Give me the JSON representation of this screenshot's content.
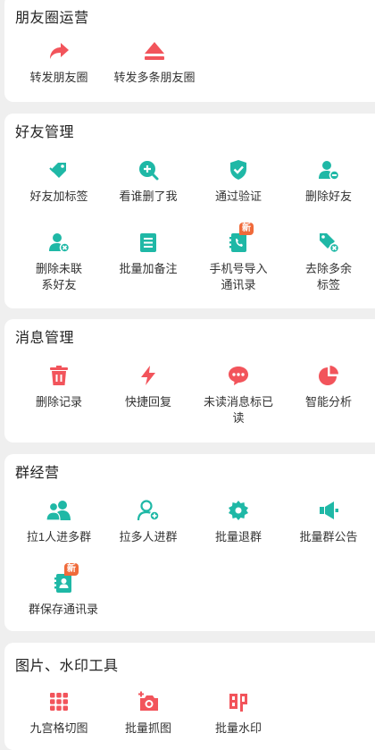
{
  "colors": {
    "teal": "#1fb8a6",
    "red": "#f2545b",
    "badge": "#f06a3a",
    "bg": "#efefef"
  },
  "sections": {
    "moments": {
      "title": "朋友圈运营",
      "items": [
        {
          "label": "转发朋友圈",
          "icon": "share-arrow-icon"
        },
        {
          "label": "转发多条朋友圈",
          "icon": "eject-icon"
        }
      ]
    },
    "friends": {
      "title": "好友管理",
      "items": [
        {
          "label": "好友加标签",
          "icon": "tag-icon"
        },
        {
          "label": "看谁删了我",
          "icon": "search-plus-icon"
        },
        {
          "label": "通过验证",
          "icon": "shield-check-icon"
        },
        {
          "label": "删除好友",
          "icon": "user-remove-icon"
        },
        {
          "label": "删除未联系好友",
          "icon": "user-delete-icon"
        },
        {
          "label": "批量加备注",
          "icon": "note-icon"
        },
        {
          "label": "手机号导入通讯录",
          "icon": "phone-book-icon",
          "badge": "新"
        },
        {
          "label": "去除多余标签",
          "icon": "tag-remove-icon"
        }
      ]
    },
    "messages": {
      "title": "消息管理",
      "items": [
        {
          "label": "删除记录",
          "icon": "trash-icon"
        },
        {
          "label": "快捷回复",
          "icon": "lightning-icon"
        },
        {
          "label": "未读消息标已读",
          "icon": "chat-bubble-icon"
        },
        {
          "label": "智能分析",
          "icon": "pie-chart-icon"
        }
      ]
    },
    "groups": {
      "title": "群经营",
      "items": [
        {
          "label": "拉1人进多群",
          "icon": "users-icon"
        },
        {
          "label": "拉多人进群",
          "icon": "users-add-icon"
        },
        {
          "label": "批量退群",
          "icon": "gear-icon"
        },
        {
          "label": "批量群公告",
          "icon": "megaphone-icon"
        },
        {
          "label": "群保存通讯录",
          "icon": "contact-book-icon",
          "badge": "新"
        }
      ]
    },
    "images": {
      "title": "图片、水印工具",
      "items": [
        {
          "label": "九宫格切图",
          "icon": "grid-icon"
        },
        {
          "label": "批量抓图",
          "icon": "camera-plus-icon"
        },
        {
          "label": "批量水印",
          "icon": "stamp-icon"
        }
      ]
    }
  }
}
